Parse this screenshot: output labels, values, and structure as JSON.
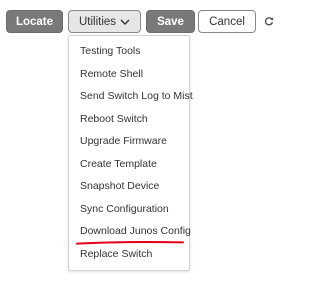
{
  "toolbar": {
    "locate_label": "Locate",
    "utilities_label": "Utilities",
    "save_label": "Save",
    "cancel_label": "Cancel",
    "refresh_icon": "refresh-icon",
    "chevron_icon": "chevron-down-icon"
  },
  "menu": {
    "items": [
      {
        "label": "Testing Tools"
      },
      {
        "label": "Remote Shell"
      },
      {
        "label": "Send Switch Log to Mist"
      },
      {
        "label": "Reboot Switch"
      },
      {
        "label": "Upgrade Firmware"
      },
      {
        "label": "Create Template"
      },
      {
        "label": "Snapshot Device"
      },
      {
        "label": "Sync Configuration"
      },
      {
        "label": "Download Junos Config"
      },
      {
        "label": "Replace Switch"
      }
    ],
    "highlight_color": "#e3001b"
  },
  "colors": {
    "dark_button": "#797979",
    "utilities_button": "#e6e6e6",
    "text": "#333333"
  }
}
